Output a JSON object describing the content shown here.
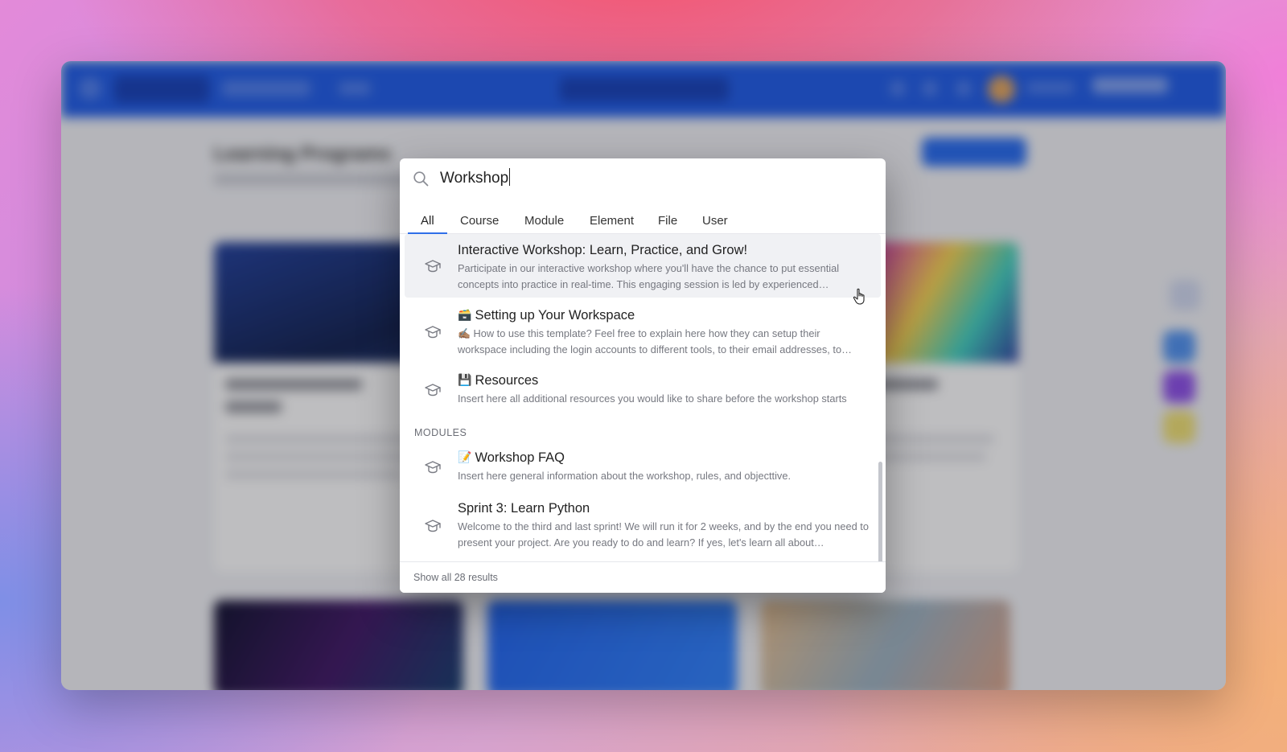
{
  "search": {
    "query": "Workshop"
  },
  "tabs": [
    {
      "label": "All",
      "active": true
    },
    {
      "label": "Course",
      "active": false
    },
    {
      "label": "Module",
      "active": false
    },
    {
      "label": "Element",
      "active": false
    },
    {
      "label": "File",
      "active": false
    },
    {
      "label": "User",
      "active": false
    }
  ],
  "results": {
    "courses": [
      {
        "icon": "graduation-cap-icon",
        "title": "Interactive Workshop: Learn, Practice, and Grow!",
        "description": "Participate in our interactive workshop where you'll have the chance to put essential concepts into practice in real-time. This engaging session is led by experienced…"
      },
      {
        "icon": "graduation-cap-icon",
        "emoji": "🗃️",
        "title": "Setting up Your Workspace",
        "desc_emoji": "✍🏽",
        "description": "How to use this template? Feel free to explain here how they can setup their workspace including the login accounts to different tools, to their email addresses, to…"
      },
      {
        "icon": "graduation-cap-icon",
        "emoji": "💾",
        "title": "Resources",
        "description": "Insert here all additional resources you would like to share before the workshop starts"
      }
    ],
    "modules_label": "MODULES",
    "modules": [
      {
        "icon": "graduation-cap-icon",
        "emoji": "📝",
        "title": "Workshop FAQ",
        "description": "Insert here general information about the workshop, rules, and objecttive."
      },
      {
        "icon": "graduation-cap-icon",
        "title": "Sprint 3: Learn Python",
        "description": "Welcome to the third and last sprint! We will run it for 2 weeks, and by the end you need to present your project. Are you ready to do and learn? If yes, let's learn all about…"
      }
    ]
  },
  "footer": {
    "show_all": "Show all 28 results"
  },
  "background_app": {
    "page_title": "Learning Programs"
  },
  "colors": {
    "accent": "#2f6fe8",
    "topbar": "#1857e8"
  }
}
